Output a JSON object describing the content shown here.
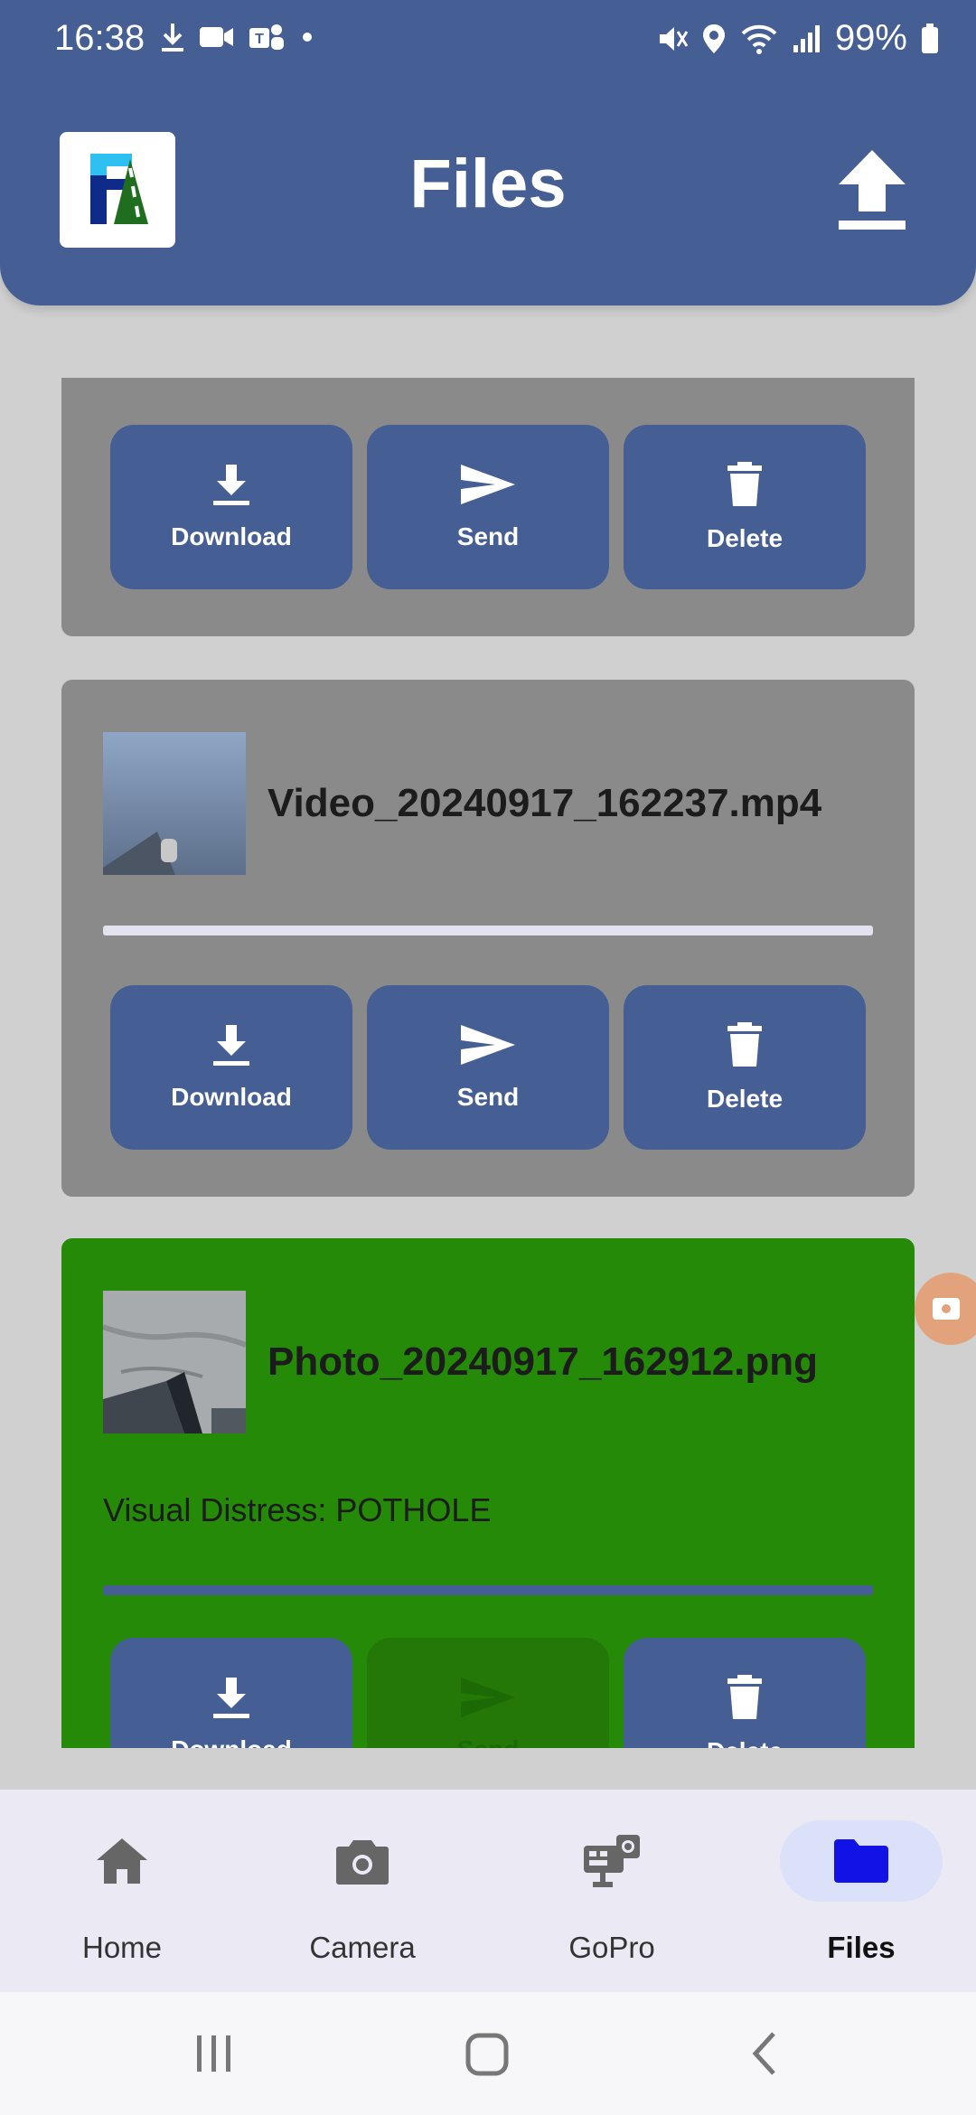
{
  "status_bar": {
    "time": "16:38",
    "battery": "99%",
    "left_icons": [
      "download-icon",
      "video-call-icon",
      "teams-icon",
      "dot-icon"
    ],
    "right_icons": [
      "mute-icon",
      "location-icon",
      "wifi-icon",
      "signal-icon",
      "battery-icon"
    ]
  },
  "header": {
    "title": "Files",
    "logo": "app-logo",
    "upload_icon": "upload-icon",
    "background": "#455e94"
  },
  "files": [
    {
      "name": "",
      "partially_visible": true,
      "buttons": [
        {
          "label": "Download",
          "icon": "download-icon"
        },
        {
          "label": "Send",
          "icon": "send-icon"
        },
        {
          "label": "Delete",
          "icon": "trash-icon"
        }
      ]
    },
    {
      "name": "Video_20240917_162237.mp4",
      "thumbnail": "video-thumbnail",
      "progress_color": "#e3e3ef",
      "buttons": [
        {
          "label": "Download",
          "icon": "download-icon"
        },
        {
          "label": "Send",
          "icon": "send-icon"
        },
        {
          "label": "Delete",
          "icon": "trash-icon"
        }
      ]
    },
    {
      "name": "Photo_20240917_162912.png",
      "thumbnail": "photo-thumbnail",
      "selected": true,
      "background": "#258a08",
      "visual_distress": "Visual Distress: POTHOLE",
      "progress_color": "#455e94",
      "buttons": [
        {
          "label": "Download",
          "icon": "download-icon"
        },
        {
          "label": "Send",
          "icon": "send-icon",
          "disabled": true
        },
        {
          "label": "Delete",
          "icon": "trash-icon"
        }
      ]
    }
  ],
  "bottom_nav": {
    "items": [
      {
        "label": "Home",
        "icon": "home-icon"
      },
      {
        "label": "Camera",
        "icon": "camera-icon"
      },
      {
        "label": "GoPro",
        "icon": "gopro-icon"
      },
      {
        "label": "Files",
        "icon": "folder-icon",
        "active": true
      }
    ]
  },
  "colors": {
    "accent": "#455e94",
    "card_grey": "#8a8a8a",
    "card_selected": "#258a08",
    "active_nav_icon": "#1212e6"
  }
}
